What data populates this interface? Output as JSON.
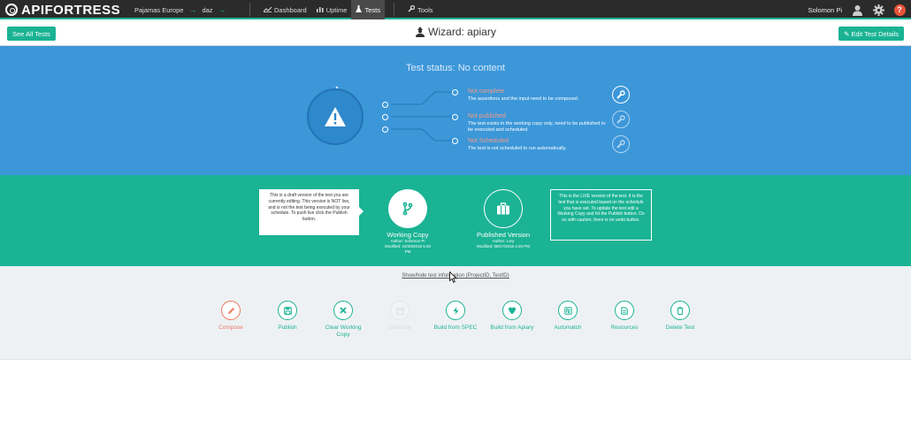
{
  "topbar": {
    "logo": "APIFORTRESS",
    "breadcrumb": [
      "Pajamas Europe",
      "daz"
    ],
    "nav": [
      {
        "label": "Dashboard",
        "icon": "chart-icon"
      },
      {
        "label": "Uptime",
        "icon": "bar-chart-icon"
      },
      {
        "label": "Tests",
        "icon": "flask-icon",
        "active": true
      },
      {
        "label": "Tools",
        "icon": "wrench-icon"
      }
    ],
    "user": "Solomon Pi"
  },
  "header": {
    "see_all": "See All Tests",
    "title": "Wizard: apiary",
    "edit": "Edit Test Details"
  },
  "status": {
    "title": "Test status: No content",
    "items": [
      {
        "title": "Not complete",
        "desc": "The assertions and the input need to be composed."
      },
      {
        "title": "Not published",
        "desc": "The test exists in the working copy only, need to be published to be executed and scheduled."
      },
      {
        "title": "Not Scheduled",
        "desc": "The test is not scheduled to run automatically."
      }
    ]
  },
  "versions": {
    "left_tip": "This is a draft version of the test you are currently editing. This version is NOT live, and is not the test being executed by your schedule. To push live click the Publish button.",
    "right_tip": "This is the LIVE version of the test. It is the test that is executed based on the schedule you have set. To update the test edit a Working Copy and hit the Publish button. Do so with caution, there is no undo button.",
    "working": {
      "name": "Working Copy",
      "author": "Author: Solomon Pi",
      "modified": "Modified: 10/28/2016 5:40 PM"
    },
    "published": {
      "name": "Published Version",
      "author": "Author: Lory",
      "modified": "Modified: 08/17/2016 4:20 PM"
    }
  },
  "actions": {
    "showhide": "Show/hide test information (ProjectID, TestID)",
    "buttons": [
      {
        "label": "Compose",
        "icon": "pencil-icon",
        "state": "red"
      },
      {
        "label": "Publish",
        "icon": "save-icon",
        "state": "normal"
      },
      {
        "label": "Clear Working Copy",
        "icon": "x-icon",
        "state": "normal"
      },
      {
        "label": "Schedule",
        "icon": "calendar-icon",
        "state": "disabled"
      },
      {
        "label": "Build from SPEC",
        "icon": "bolt-icon",
        "state": "normal"
      },
      {
        "label": "Build from Apiary",
        "icon": "apiary-icon",
        "state": "normal"
      },
      {
        "label": "Automatch",
        "icon": "automatch-icon",
        "state": "normal"
      },
      {
        "label": "Resources",
        "icon": "document-icon",
        "state": "normal"
      },
      {
        "label": "Delete Test",
        "icon": "trash-icon",
        "state": "normal"
      }
    ]
  },
  "colors": {
    "accent": "#1ab394",
    "status_blue": "#3c97d9",
    "warn": "#f39b83",
    "topbar": "#2b2b2b"
  }
}
